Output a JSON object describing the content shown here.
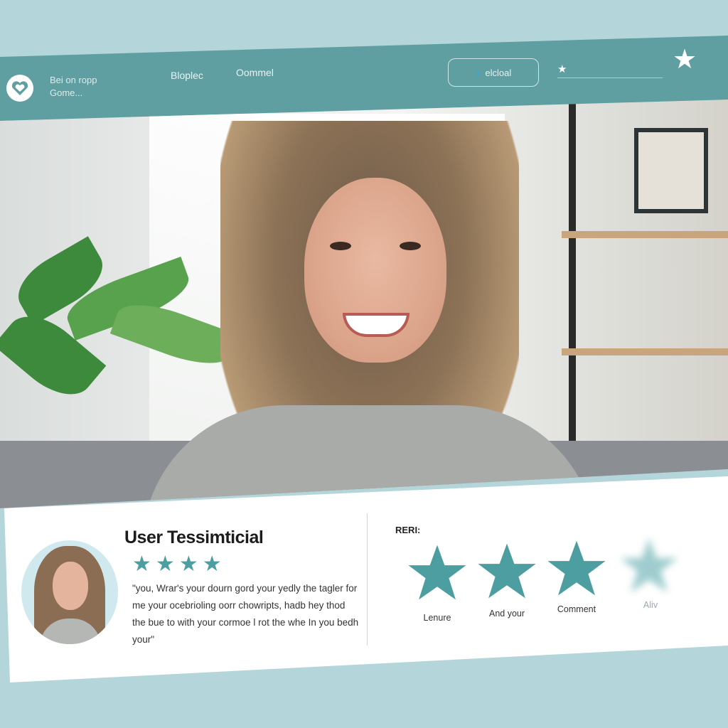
{
  "header": {
    "brand_line1": "Bei on ropp",
    "brand_line2": "Gome...",
    "nav": [
      {
        "label": "Bloplec"
      },
      {
        "label": "Oommel"
      }
    ],
    "button_label": "elcloal",
    "search_prefix_icon": "star-icon",
    "corner_icon": "star-icon"
  },
  "testimonial": {
    "title": "User Tessimticial",
    "stars_shown": 4,
    "quote": "\"you, Wrar's your dourn gord your yedly the tagler for me your ocebrioling oorr chowripts, hadb hey thod the bue to with your cormoe l rot the whe In you bedh your\"",
    "rating_label": "RERI:",
    "rating_options": [
      {
        "caption": "Lenure",
        "faded": false
      },
      {
        "caption": "And your",
        "faded": false
      },
      {
        "caption": "Comment",
        "faded": false
      },
      {
        "caption": "Aliv",
        "faded": true
      }
    ]
  },
  "colors": {
    "accent": "#5f9fa2",
    "star": "#4c9ea1",
    "background": "#b4d6db"
  }
}
